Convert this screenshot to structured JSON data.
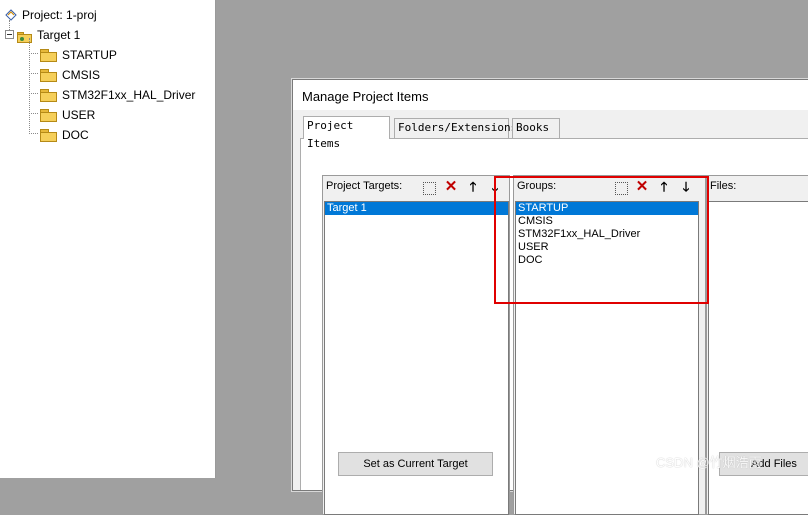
{
  "project_panel": {
    "root_label": "Project: 1-proj",
    "target_label": "Target 1",
    "groups": [
      "STARTUP",
      "CMSIS",
      "STM32F1xx_HAL_Driver",
      "USER",
      "DOC"
    ]
  },
  "dialog": {
    "title": "Manage Project Items",
    "tabs": [
      "Project Items",
      "Folders/Extensions",
      "Books"
    ],
    "active_tab": "Project Items"
  },
  "targets_box": {
    "label": "Project Targets:",
    "items": [
      "Target 1"
    ],
    "selected": "Target 1"
  },
  "groups_box": {
    "label": "Groups:",
    "items": [
      "STARTUP",
      "CMSIS",
      "STM32F1xx_HAL_Driver",
      "USER",
      "DOC"
    ],
    "selected": "STARTUP"
  },
  "files_box": {
    "label": "Files:"
  },
  "buttons": {
    "set_current_target": "Set as Current Target",
    "add_files": "Add Files"
  },
  "toolbar_icons": [
    "new-icon",
    "delete-icon",
    "move-up-icon",
    "move-down-icon"
  ],
  "colors": {
    "selection": "#0078d7",
    "highlight_box": "#e00000",
    "delete_icon": "#c00000"
  },
  "watermark": "CSDN @竹烟浩雨"
}
